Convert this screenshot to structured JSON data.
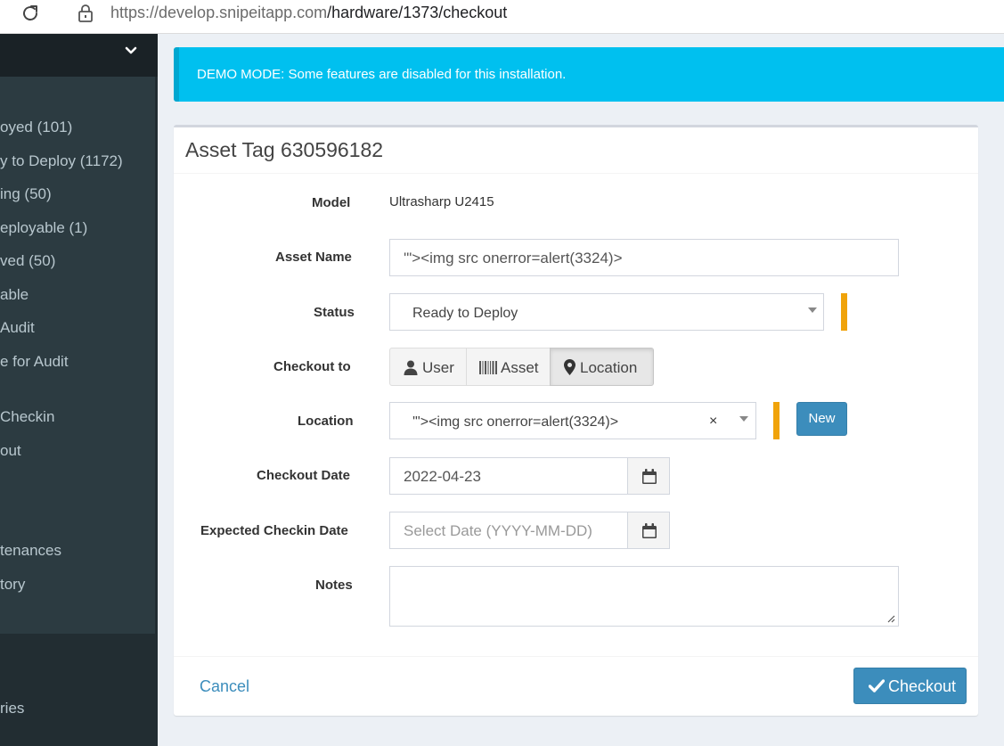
{
  "browser": {
    "url_host": "https://develop.snipeitapp.com",
    "url_path": "/hardware/1373/checkout"
  },
  "sidebar": {
    "items": [
      {
        "label": "oyed (101)"
      },
      {
        "label": "y to Deploy (1172)"
      },
      {
        "label": "ing (50)"
      },
      {
        "label": "eployable (1)"
      },
      {
        "label": "ved (50)"
      },
      {
        "label": "able"
      },
      {
        "label": " Audit"
      },
      {
        "label": "e for Audit"
      },
      {
        "label": " Checkin"
      },
      {
        "label": "out"
      },
      {
        "label": "tenances"
      },
      {
        "label": "tory"
      },
      {
        "label": "ries"
      }
    ]
  },
  "alert": {
    "text": "DEMO MODE: Some features are disabled for this installation."
  },
  "form": {
    "title": "Asset Tag 630596182",
    "model_label": "Model",
    "model_value": "Ultrasharp U2415",
    "asset_name_label": "Asset Name",
    "asset_name_value": "'\"><img src onerror=alert(3324)>",
    "status_label": "Status",
    "status_value": "Ready to Deploy",
    "checkout_to_label": "Checkout to",
    "checkout_options": [
      "User",
      "Asset",
      "Location"
    ],
    "checkout_selected": "Location",
    "location_label": "Location",
    "location_value": "'\"><img src onerror=alert(3324)>",
    "location_clear": "×",
    "new_button": "New",
    "checkout_date_label": "Checkout Date",
    "checkout_date_value": "2022-04-23",
    "expected_checkin_label": "Expected Checkin Date",
    "expected_checkin_placeholder": "Select Date (YYYY-MM-DD)",
    "notes_label": "Notes",
    "notes_value": "",
    "cancel_label": "Cancel",
    "submit_label": "Checkout"
  },
  "colors": {
    "accent": "#3c8dbc",
    "alert": "#00c0ef",
    "required": "#f0a30a",
    "sidebar": "#222d32"
  },
  "icons": [
    "reload-icon",
    "lock-icon",
    "chevron-down-icon",
    "user-icon",
    "barcode-icon",
    "map-marker-icon",
    "calendar-icon",
    "check-icon",
    "caret-down-icon",
    "resize-grip-icon"
  ]
}
